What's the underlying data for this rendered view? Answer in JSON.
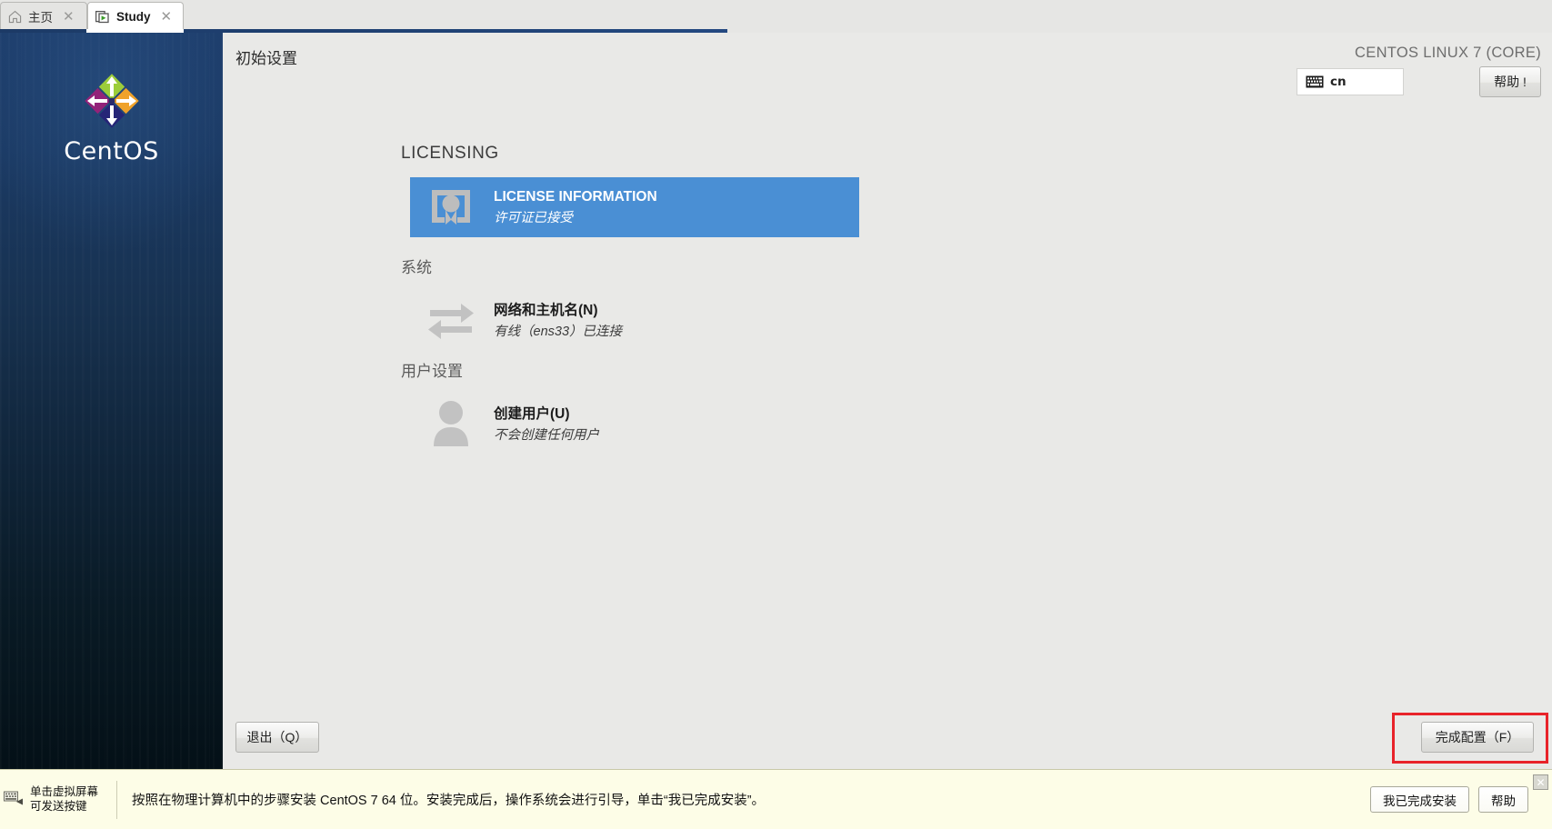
{
  "tabs": [
    {
      "label": "主页",
      "icon": "home-icon",
      "active": false
    },
    {
      "label": "Study",
      "icon": "vm-play-icon",
      "active": true
    }
  ],
  "sidebar": {
    "logo_text": "CentOS",
    "logo_icon": "centos-logo-icon"
  },
  "header": {
    "title": "初始设置",
    "distro": "CENTOS LINUX 7 (CORE)",
    "keyboard_layout": "cn",
    "keyboard_icon": "keyboard-icon",
    "help_label": "帮助 !"
  },
  "hub": {
    "sections": [
      {
        "title": "LICENSING",
        "title_style": "en",
        "items": [
          {
            "icon": "license-certificate-icon",
            "title": "LICENSE INFORMATION",
            "status": "许可证已接受",
            "selected": true
          }
        ]
      },
      {
        "title": "系统",
        "title_style": "cn",
        "items": [
          {
            "icon": "network-arrows-icon",
            "title": "网络和主机名(N)",
            "status": "有线（ens33）已连接",
            "selected": false
          }
        ]
      },
      {
        "title": "用户设置",
        "title_style": "cn",
        "items": [
          {
            "icon": "user-avatar-icon",
            "title": "创建用户(U)",
            "status": "不会创建任何用户",
            "selected": false
          }
        ]
      }
    ]
  },
  "footer": {
    "quit_label": "退出（Q）",
    "finish_label": "完成配置（F）",
    "highlight_color": "#e8232a"
  },
  "statusbar": {
    "hint_line1": "单击虚拟屏幕",
    "hint_line2": "可发送按键",
    "hint_icon": "keyboard-send-icon",
    "message": "按照在物理计算机中的步骤安装 CentOS 7 64 位。安装完成后，操作系统会进行引导，单击“我已完成安装”。",
    "done_label": "我已完成安装",
    "help_label": "帮助",
    "close_icon": "close-icon"
  },
  "colors": {
    "accent_blue": "#4a8fd4",
    "sidebar_top": "#1d3d6b",
    "sidebar_bottom": "#041017",
    "panel_bg": "#e9e9e7",
    "statusbar_bg": "#fdfde7"
  }
}
